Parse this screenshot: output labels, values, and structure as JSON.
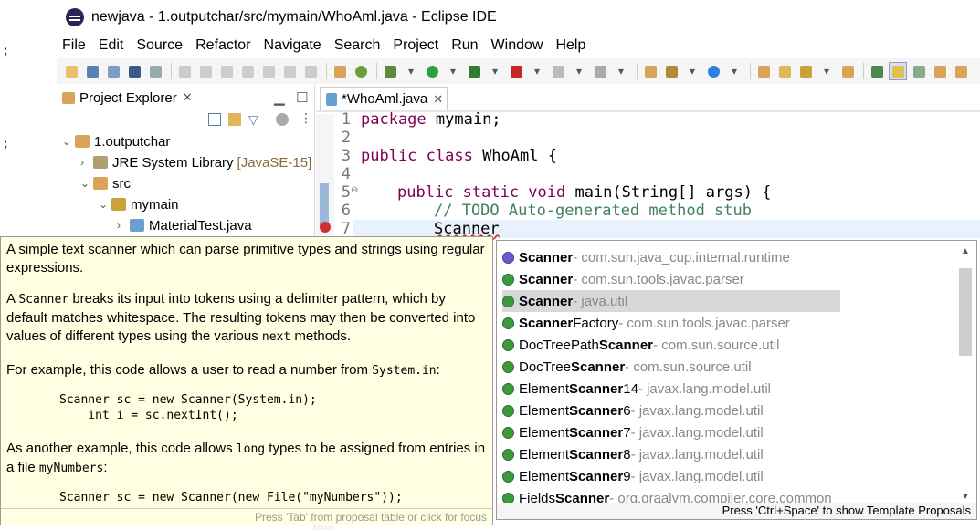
{
  "window": {
    "title": "newjava - 1.outputchar/src/mymain/WhoAml.java - Eclipse IDE"
  },
  "menu": [
    "File",
    "Edit",
    "Source",
    "Refactor",
    "Navigate",
    "Search",
    "Project",
    "Run",
    "Window",
    "Help"
  ],
  "explorer": {
    "tab_label": "Project Explorer",
    "tree": {
      "project": "1.outputchar",
      "jre": "JRE System Library",
      "jre_tag": "[JavaSE-15]",
      "src": "src",
      "package": "mymain",
      "file": "MaterialTest.java"
    }
  },
  "editor": {
    "tab_label": "*WhoAml.java",
    "line_numbers": [
      "1",
      "2",
      "3",
      "4",
      "5",
      "6",
      "7"
    ],
    "lines": {
      "l1_kw": "package",
      "l1_rest": " mymain;",
      "l3_kw": "public class",
      "l3_rest": " WhoAml {",
      "l5_kw": "public static void",
      "l5_rest": " main(String[] args) {",
      "l6": "// TODO Auto-generated method stub",
      "l7": "Scanner"
    }
  },
  "tooltip": {
    "p1": "A simple text scanner which can parse primitive types and strings using regular expressions.",
    "p2a_code": "Scanner",
    "p2b": " breaks its input into tokens using a delimiter pattern, which by default matches whitespace. The resulting tokens may then be converted into values of different types using the various ",
    "p2c_code": "next",
    "p2d": " methods.",
    "p2_prefix": "A ",
    "p3a": "For example, this code allows a user to read a number from ",
    "p3b_code": "System.in",
    "p3c": ":",
    "code1": "Scanner sc = new Scanner(System.in);",
    "code2": "    int i = sc.nextInt();",
    "p4a": "As another example, this code allows ",
    "p4b_code": "long",
    "p4c": " types to be assigned from entries in a file ",
    "p4d_code": "myNumbers",
    "p4e": ":",
    "code3": "Scanner sc = new Scanner(new File(\"myNumbers\"));",
    "footer": "Press 'Tab' from proposal table or click for focus"
  },
  "proposals": {
    "items": [
      {
        "bold": "Scanner",
        "rest": "",
        "pkg": " - com.sun.java_cup.internal.runtime",
        "kind": "interface"
      },
      {
        "bold": "Scanner",
        "rest": "",
        "pkg": " - com.sun.tools.javac.parser",
        "kind": "class"
      },
      {
        "bold": "Scanner",
        "rest": "",
        "pkg": " - java.util",
        "kind": "class"
      },
      {
        "bold": "Scanner",
        "rest": "Factory",
        "pkg": " - com.sun.tools.javac.parser",
        "kind": "class"
      },
      {
        "pre": "DocTreePath",
        "bold": "Scanner",
        "pkg": " - com.sun.source.util",
        "kind": "class"
      },
      {
        "pre": "DocTree",
        "bold": "Scanner",
        "pkg": " - com.sun.source.util",
        "kind": "class"
      },
      {
        "pre": "Element",
        "bold": "Scanner",
        "rest": "14",
        "pkg": " - javax.lang.model.util",
        "kind": "class"
      },
      {
        "pre": "Element",
        "bold": "Scanner",
        "rest": "6",
        "pkg": " - javax.lang.model.util",
        "kind": "class"
      },
      {
        "pre": "Element",
        "bold": "Scanner",
        "rest": "7",
        "pkg": " - javax.lang.model.util",
        "kind": "class"
      },
      {
        "pre": "Element",
        "bold": "Scanner",
        "rest": "8",
        "pkg": " - javax.lang.model.util",
        "kind": "class"
      },
      {
        "pre": "Element",
        "bold": "Scanner",
        "rest": "9",
        "pkg": " - javax.lang.model.util",
        "kind": "class"
      },
      {
        "pre": "Fields",
        "bold": "Scanner",
        "pkg": " - org.graalvm.compiler.core.common",
        "kind": "class"
      }
    ],
    "selected_index": 2,
    "footer": "Press 'Ctrl+Space' to show Template Proposals"
  },
  "colors": {
    "keyword": "#7f0055",
    "comment": "#3f7f5f",
    "jre_tag": "#8b6a3a"
  }
}
